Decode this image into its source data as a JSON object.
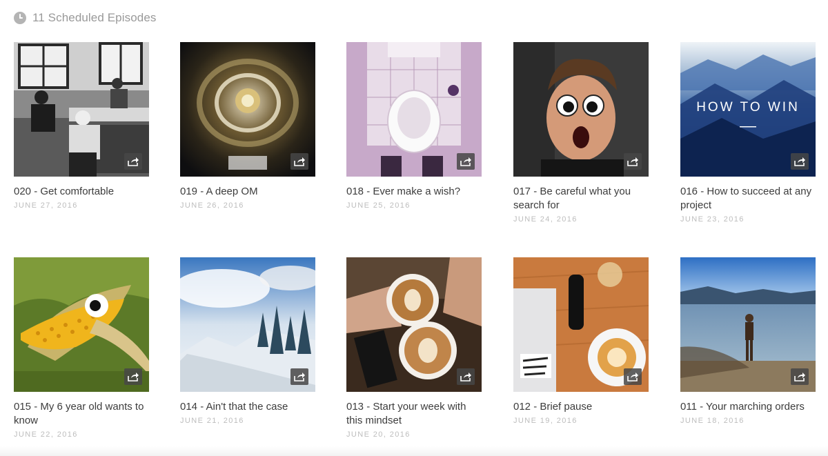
{
  "header": {
    "title": "11 Scheduled Episodes",
    "icon": "clock-icon"
  },
  "episodes": [
    {
      "title": "020 - Get comfortable",
      "date": "JUNE 27, 2016",
      "art": "vintage-office-photo"
    },
    {
      "title": "019 - A deep OM",
      "date": "JUNE 26, 2016",
      "art": "spinning-drain-photo"
    },
    {
      "title": "018 - Ever make a wish?",
      "date": "JUNE 25, 2016",
      "art": "toilet-photo"
    },
    {
      "title": "017 - Be careful what you search for",
      "date": "JUNE 24, 2016",
      "art": "googly-eyes-face-photo"
    },
    {
      "title": "016 - How to succeed at any project",
      "date": "JUNE 23, 2016",
      "art": "mountains-how-to-win",
      "overlay_text": "HOW TO WIN"
    },
    {
      "title": "015 - My 6 year old wants to know",
      "date": "JUNE 22, 2016",
      "art": "corn-with-eye-photo"
    },
    {
      "title": "014 - Ain't that the case",
      "date": "JUNE 21, 2016",
      "art": "snowy-mountain-photo"
    },
    {
      "title": "013 - Start your week with this mindset",
      "date": "JUNE 20, 2016",
      "art": "latte-art-photo"
    },
    {
      "title": "012 - Brief pause",
      "date": "JUNE 19, 2016",
      "art": "coffee-desk-photo"
    },
    {
      "title": "011 - Your marching orders",
      "date": "JUNE 18, 2016",
      "art": "lake-child-photo"
    }
  ],
  "share_icon": "share-icon"
}
